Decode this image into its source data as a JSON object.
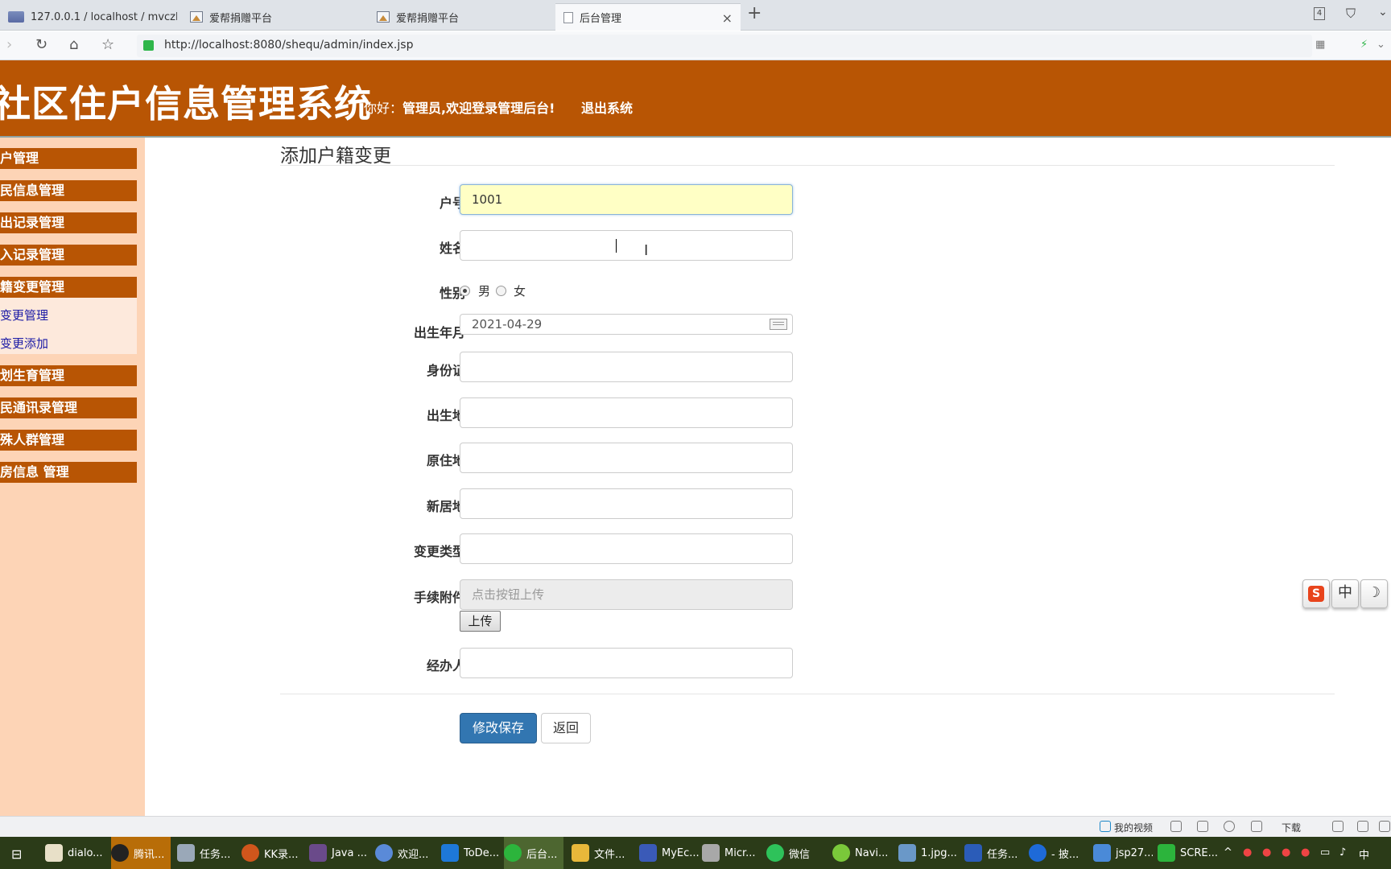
{
  "browser": {
    "tabs": [
      {
        "label": "127.0.0.1 / localhost / mvczh",
        "icon": "phpmyadmin-icon"
      },
      {
        "label": "爱帮捐赠平台",
        "icon": "image-icon"
      },
      {
        "label": "爱帮捐赠平台",
        "icon": "image-icon"
      },
      {
        "label": "后台管理",
        "icon": "document-icon",
        "active": true
      }
    ],
    "tab_count": "4",
    "url": "http://localhost:8080/shequ/admin/index.jsp"
  },
  "header": {
    "app_title": "社区住户信息管理系统",
    "greeting": "你好：",
    "user_welcome": "管理员,欢迎登录管理后台!",
    "logout": "退出系统"
  },
  "sidebar": {
    "menus": [
      {
        "label": "用户管理"
      },
      {
        "label": "居民信息管理"
      },
      {
        "label": "迁出记录管理"
      },
      {
        "label": "迁入记录管理"
      },
      {
        "label": "户籍变更管理",
        "expanded": true,
        "items": [
          "户籍变更管理",
          "户籍变更添加"
        ]
      },
      {
        "label": "计划生育管理"
      },
      {
        "label": "居民通讯录管理"
      },
      {
        "label": "特殊人群管理"
      },
      {
        "label": "出房信息 管理"
      }
    ]
  },
  "form": {
    "title": "添加户籍变更",
    "fields": {
      "huhao": {
        "label": "户号",
        "value": "1001"
      },
      "name": {
        "label": "姓名",
        "value": ""
      },
      "gender": {
        "label": "性别",
        "options": [
          "男",
          "女"
        ],
        "selected": "男"
      },
      "birth": {
        "label": "出生年月",
        "value": "2021-04-29"
      },
      "idcard": {
        "label": "身份证",
        "value": ""
      },
      "birthplace": {
        "label": "出生地",
        "value": ""
      },
      "oldaddr": {
        "label": "原住地",
        "value": ""
      },
      "newaddr": {
        "label": "新居地",
        "value": ""
      },
      "changetype": {
        "label": "变更类型",
        "value": ""
      },
      "attachment": {
        "label": "手续附件",
        "placeholder": "点击按钮上传"
      },
      "handler": {
        "label": "经办人",
        "value": ""
      }
    },
    "upload_button": "上传",
    "save_button": "修改保存",
    "back_button": "返回"
  },
  "ime": {
    "items": [
      "S",
      "中",
      "☽"
    ]
  },
  "statusbar": {
    "my_video": "我的视频",
    "download": "下载"
  },
  "taskbar": {
    "items": [
      "dialo...",
      "腾讯...",
      "任务...",
      "KK录...",
      "Java ...",
      "欢迎...",
      "ToDe...",
      "后台...",
      "文件...",
      "MyEc...",
      "Micr...",
      "微信",
      "Navi...",
      "1.jpg...",
      "任务...",
      "- 披...",
      "jsp27...",
      "SCRE..."
    ],
    "active_index": 7,
    "ime_indicator": "中"
  },
  "colors": {
    "header_bg": "#b85504",
    "sidebar_bg": "#fdd4b6",
    "primary_button": "#3276b1",
    "focused_input": "#ffffc5"
  }
}
